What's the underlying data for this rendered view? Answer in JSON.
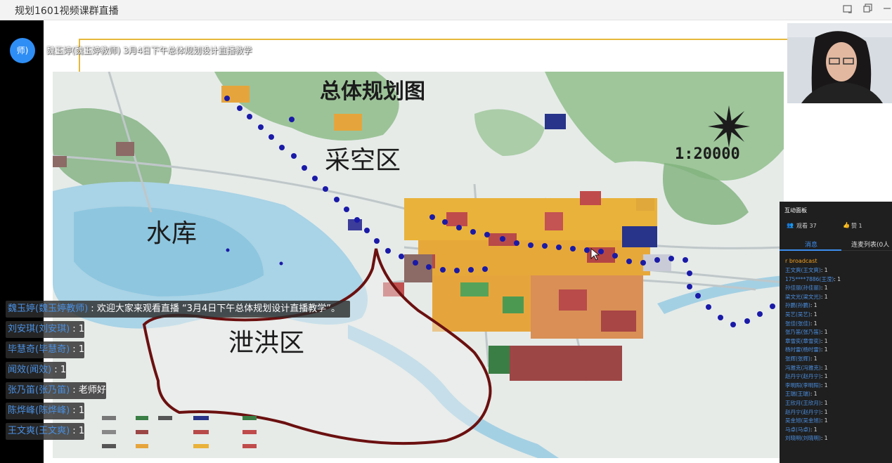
{
  "window": {
    "title": "规划1601视频课群直播",
    "controls": [
      "restore-icon",
      "maximize-icon",
      "minimize-icon"
    ]
  },
  "teacher_badge": "师)",
  "share_title": "魏玉婷(魏玉婷教师) 3月4日下午总体规划设计直播教学",
  "map": {
    "title": "总体规划图",
    "scale": "1:20000",
    "labels": {
      "mining": "采空区",
      "reservoir": "水库",
      "flood": "泄洪区"
    }
  },
  "chat": [
    {
      "name": "魏玉婷(魏玉婷教师)",
      "text": "欢迎大家来观看直播 “3月4日下午总体规划设计直播教学”。"
    },
    {
      "name": "刘安琪(刘安琪)",
      "text": "1"
    },
    {
      "name": "毕慧奇(毕慧奇)",
      "text": "1"
    },
    {
      "name": "闻效(闻效)",
      "text": "1"
    },
    {
      "name": "张乃笛(张乃笛)",
      "text": "老师好"
    },
    {
      "name": "陈烨峰(陈烨峰)",
      "text": "1"
    },
    {
      "name": "王文爽(王文爽)",
      "text": "1"
    }
  ],
  "panel": {
    "title": "互动面板",
    "viewers": "观看 37",
    "likes": "赞 1",
    "tab_messages": "消息",
    "tab_mic": "连麦列表(0人",
    "broadcast": "r broadcast",
    "messages": [
      {
        "name": "王文爽(王文爽)",
        "text": "1"
      },
      {
        "name": "175****7886(王滢)",
        "text": "1"
      },
      {
        "name": "孙佳丽(孙佳丽)",
        "text": "1"
      },
      {
        "name": "梁文光(梁文光)",
        "text": "1"
      },
      {
        "name": "孙鹏(孙鹏)",
        "text": "1"
      },
      {
        "name": "吴艺(吴艺)",
        "text": "1"
      },
      {
        "name": "张佳(张佳)",
        "text": "1"
      },
      {
        "name": "张乃笛(张乃笛)",
        "text": "1"
      },
      {
        "name": "章雪奕(章雪奕)",
        "text": "1"
      },
      {
        "name": "杨时雷(杨时雷)",
        "text": "1"
      },
      {
        "name": "张辉(张辉)",
        "text": "1"
      },
      {
        "name": "冯雅克(冯雅克)",
        "text": "1"
      },
      {
        "name": "赵丹宁(赵丹宁)",
        "text": "1"
      },
      {
        "name": "李明阳(李明阳)",
        "text": "1"
      },
      {
        "name": "王瑞(王瑞)",
        "text": "1"
      },
      {
        "name": "王欣月(王欣月)",
        "text": "1"
      },
      {
        "name": "赵丹宁(赵丹宁)",
        "text": "1"
      },
      {
        "name": "吴金旭(吴金旭)",
        "text": "1"
      },
      {
        "name": "马卓(马卓)",
        "text": "1"
      },
      {
        "name": "刘晓明(刘晓明)",
        "text": "1"
      }
    ]
  },
  "colors": {
    "accent_blue": "#3d8ef0",
    "name_blue": "#4a90e2",
    "frame_gold": "#e6b83a",
    "broadcast_orange": "#f0a020",
    "dot_navy": "#1a1aa8",
    "flood_outline": "#6b1010"
  }
}
